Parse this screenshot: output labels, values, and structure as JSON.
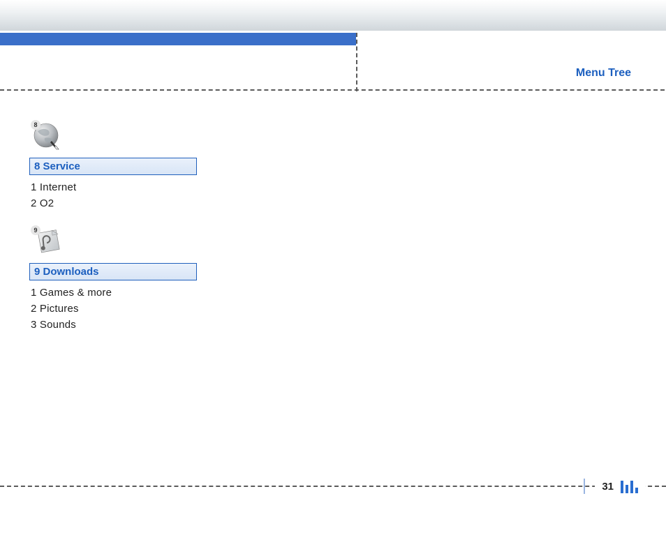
{
  "breadcrumb": "Menu Tree",
  "sections": [
    {
      "badge": "8",
      "header": "8 Service",
      "items": [
        "1 Internet",
        "2 O2"
      ]
    },
    {
      "badge": "9",
      "header": "9 Downloads",
      "items": [
        "1 Games & more",
        "2 Pictures",
        "3 Sounds"
      ]
    }
  ],
  "page_number": "31"
}
